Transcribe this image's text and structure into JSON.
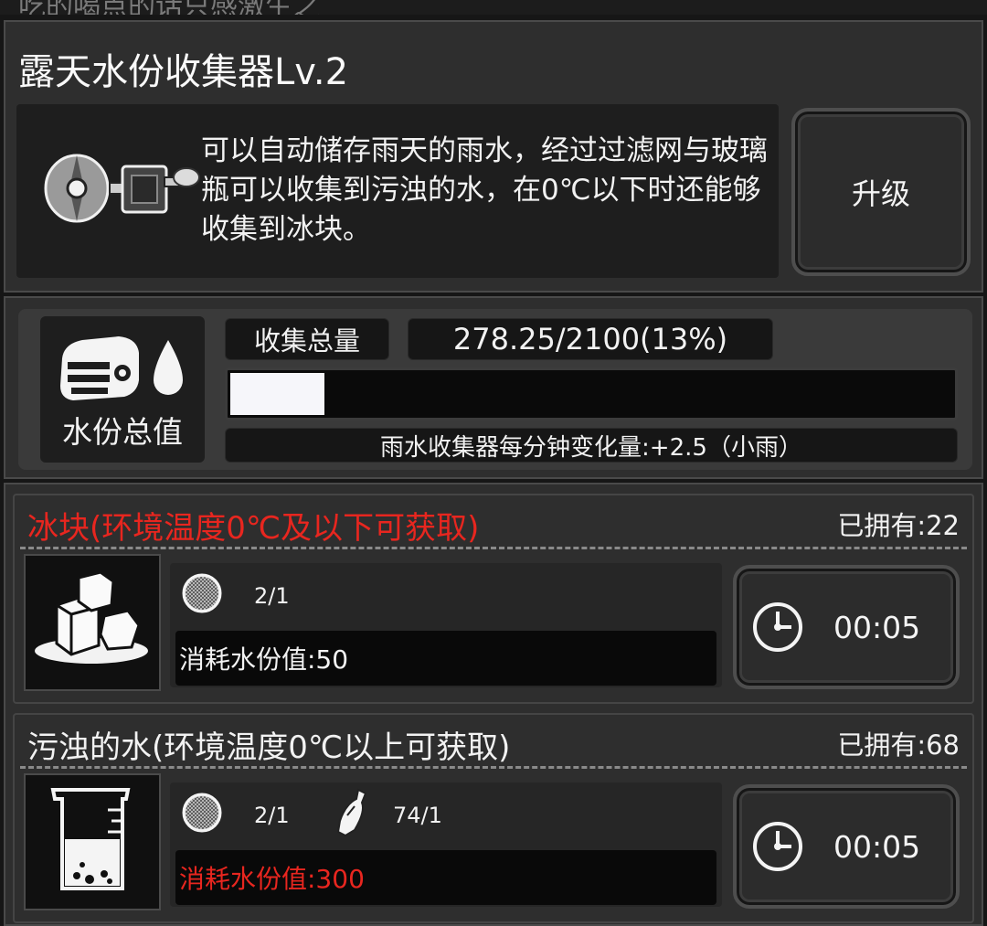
{
  "top_strip": {
    "text": "吃的喝点的话只感激生之"
  },
  "building": {
    "title": "露天水份收集器Lv.2",
    "description": "可以自动储存雨天的雨水，经过过滤网与玻璃瓶可以收集到污浊的水，在0℃以下时还能够收集到冰块。",
    "upgrade_label": "升级"
  },
  "water": {
    "icon_label": "水份总值",
    "total_label": "收集总量",
    "total_value": "278.25/2100(13%)",
    "fill_fraction": 0.13,
    "rate_text": "雨水收集器每分钟变化量:+2.5（小雨）"
  },
  "recipes": [
    {
      "title": "冰块(环境温度0℃及以下可获取)",
      "title_color": "#e8261f",
      "owned": "已拥有:22",
      "costs": [
        {
          "icon": "filter-mesh-icon",
          "text": "2/1"
        }
      ],
      "consume": "消耗水份值:50",
      "consume_color": "#f2f2f2",
      "timer": "00:05",
      "item_icon": "ice-cubes-icon"
    },
    {
      "title": "污浊的水(环境温度0℃以上可获取)",
      "title_color": "#f2f2f2",
      "owned": "已拥有:68",
      "costs": [
        {
          "icon": "filter-mesh-icon",
          "text": "2/1"
        },
        {
          "icon": "glass-bottle-icon",
          "text": "74/1"
        }
      ],
      "consume": "消耗水份值:300",
      "consume_color": "#e8261f",
      "timer": "00:05",
      "item_icon": "dirty-water-beaker-icon"
    }
  ]
}
